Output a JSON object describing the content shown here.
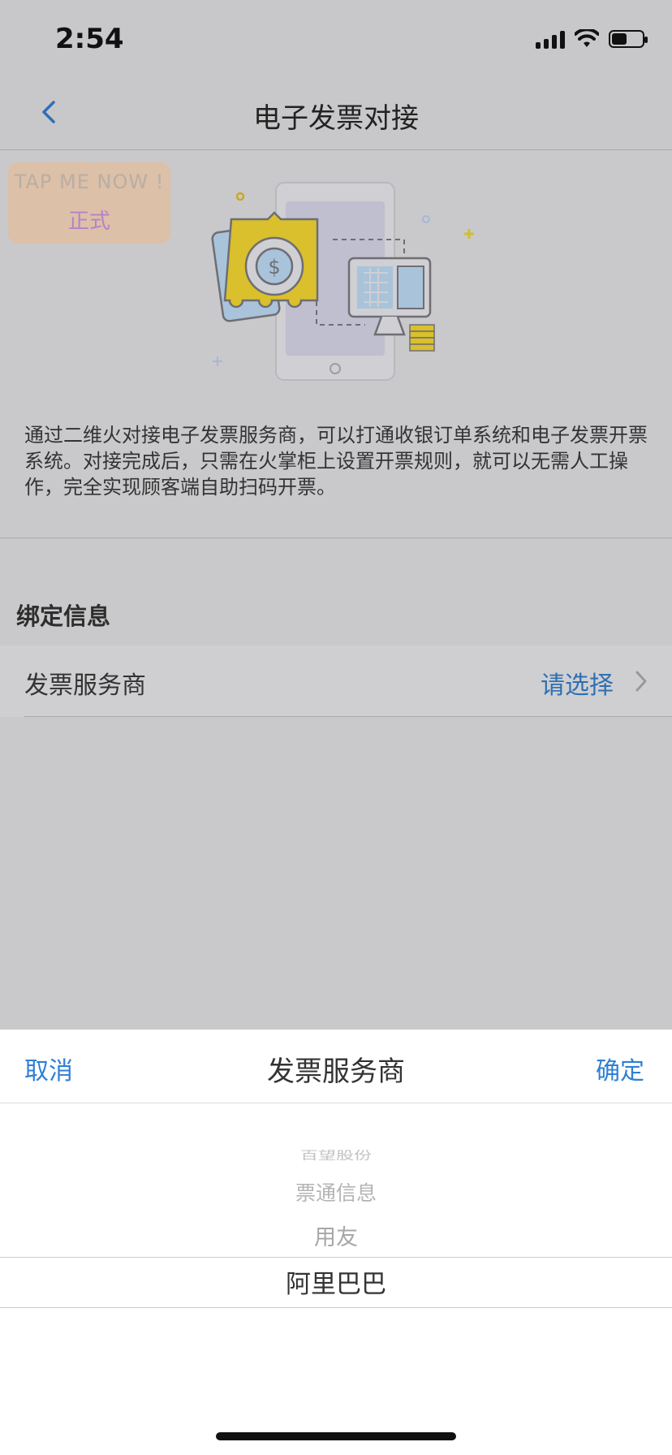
{
  "status": {
    "time": "2:54"
  },
  "nav": {
    "title": "电子发票对接",
    "back_icon": "chevron-left-icon"
  },
  "badge": {
    "line1": "TAP ME NOW !",
    "line2": "正式"
  },
  "description": "通过二维火对接电子发票服务商，可以打通收银订单系统和电子发票开票系统。对接完成后，只需在火掌柜上设置开票规则，就可以无需人工操作，完全实现顾客端自助扫码开票。",
  "binding": {
    "section_title": "绑定信息",
    "provider_label": "发票服务商",
    "provider_value": "请选择"
  },
  "picker": {
    "cancel": "取消",
    "title": "发票服务商",
    "confirm": "确定",
    "options": [
      "百望股份",
      "票通信息",
      "用友",
      "阿里巴巴"
    ],
    "selected": "阿里巴巴"
  },
  "colors": {
    "accent": "#2f7fd6",
    "illustration_yellow": "#d9c02c",
    "illustration_blue": "#a9c3da"
  }
}
